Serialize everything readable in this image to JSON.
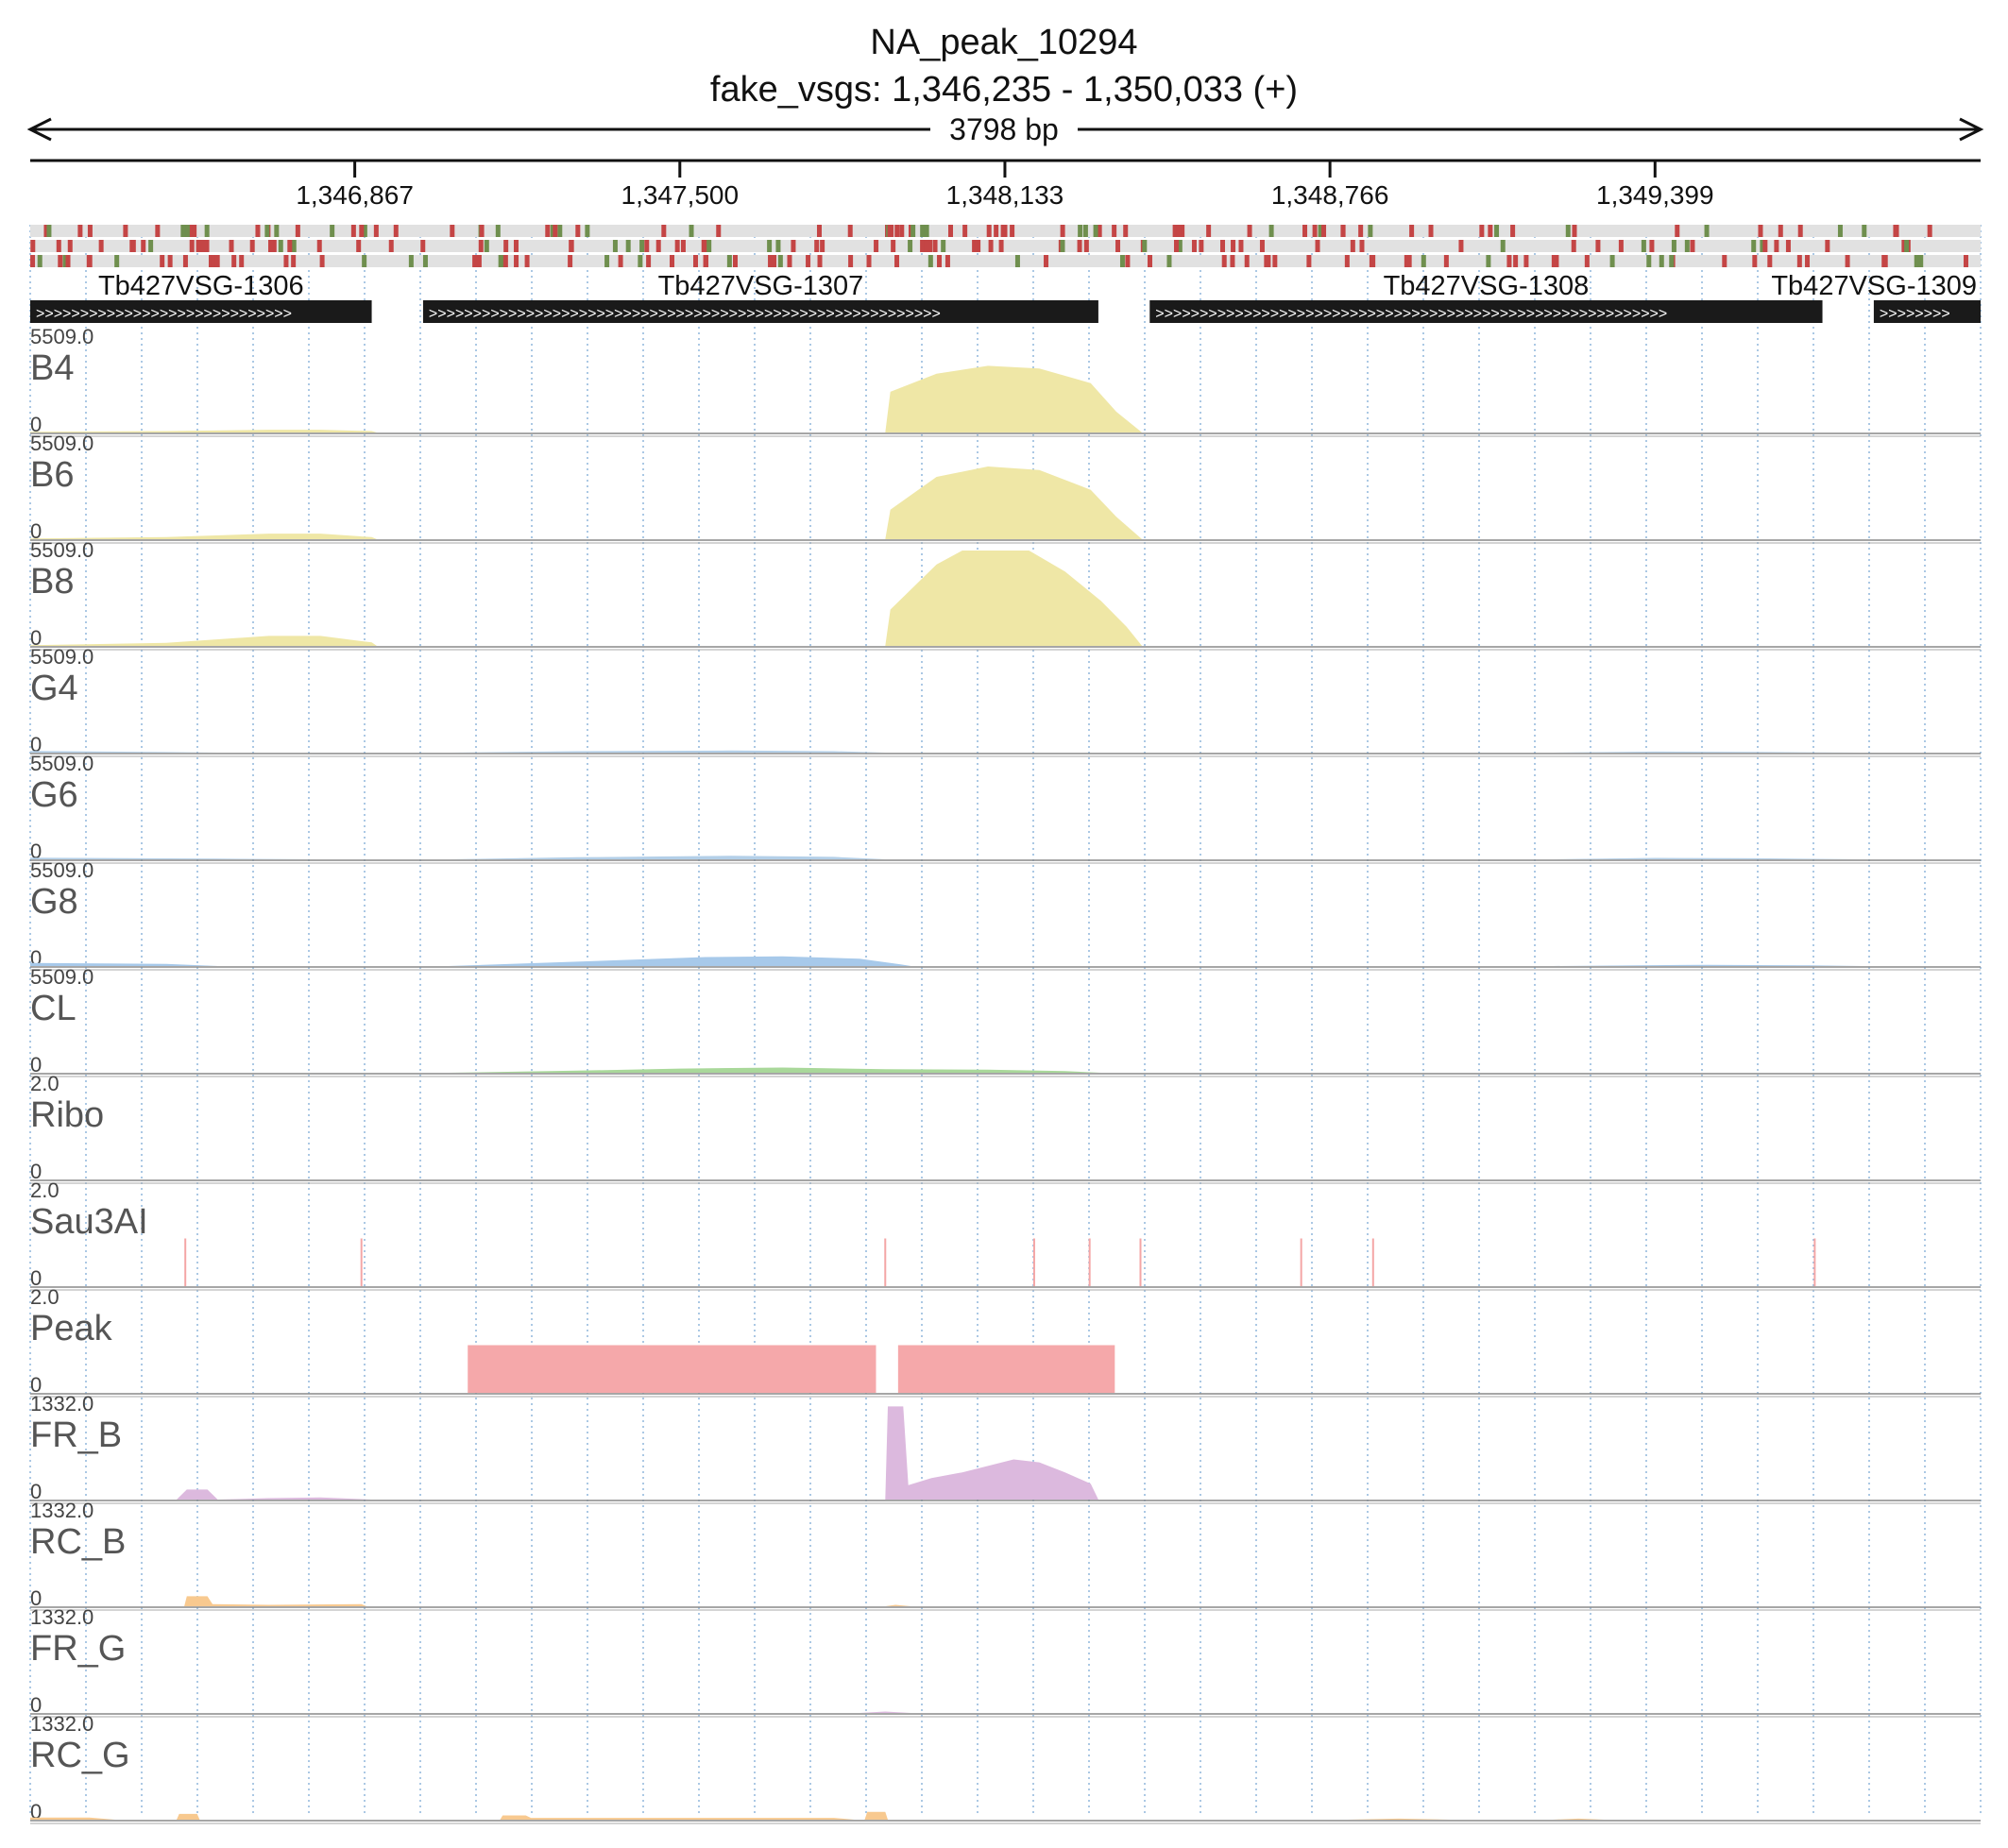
{
  "header": {
    "title": "NA_peak_10294",
    "subtitle": "fake_vsgs: 1,346,235 - 1,350,033 (+)",
    "span_label": "3798 bp"
  },
  "chart_data": {
    "type": "area",
    "title": "NA_peak_10294",
    "subtitle": "fake_vsgs: 1,346,235 - 1,350,033 (+)",
    "x_range": [
      1346235,
      1350033
    ],
    "x_ticks": [
      {
        "value": 1346867,
        "label": "1,346,867"
      },
      {
        "value": 1347500,
        "label": "1,347,500"
      },
      {
        "value": 1348133,
        "label": "1,348,133"
      },
      {
        "value": 1348766,
        "label": "1,348,766"
      },
      {
        "value": 1349399,
        "label": "1,349,399"
      }
    ],
    "grid": true,
    "genes": [
      {
        "name": "Tb427VSG-1306",
        "start": 1346235,
        "end": 1346900,
        "strand": "+"
      },
      {
        "name": "Tb427VSG-1307",
        "start": 1347000,
        "end": 1348315,
        "strand": "+"
      },
      {
        "name": "Tb427VSG-1308",
        "start": 1348415,
        "end": 1349725,
        "strand": "+"
      },
      {
        "name": "Tb427VSG-1309",
        "start": 1349825,
        "end": 1350033,
        "strand": "+"
      }
    ],
    "tracks": [
      {
        "name": "B4",
        "ymax_label": "5509.0",
        "ymin_label": "0",
        "ylim": [
          0,
          5509
        ],
        "color": "#efe7a6",
        "points": [
          [
            1346235,
            40
          ],
          [
            1346500,
            80
          ],
          [
            1346700,
            160
          ],
          [
            1346800,
            160
          ],
          [
            1346900,
            80
          ],
          [
            1346910,
            0
          ],
          [
            1347900,
            0
          ],
          [
            1347910,
            2350
          ],
          [
            1348000,
            3400
          ],
          [
            1348100,
            3850
          ],
          [
            1348200,
            3700
          ],
          [
            1348300,
            2850
          ],
          [
            1348350,
            1200
          ],
          [
            1348400,
            0
          ]
        ]
      },
      {
        "name": "B6",
        "ymax_label": "5509.0",
        "ymin_label": "0",
        "ylim": [
          0,
          5509
        ],
        "color": "#efe7a6",
        "points": [
          [
            1346235,
            40
          ],
          [
            1346500,
            120
          ],
          [
            1346700,
            320
          ],
          [
            1346800,
            320
          ],
          [
            1346900,
            120
          ],
          [
            1346910,
            0
          ],
          [
            1347900,
            0
          ],
          [
            1347910,
            1700
          ],
          [
            1348000,
            3600
          ],
          [
            1348100,
            4200
          ],
          [
            1348200,
            4000
          ],
          [
            1348300,
            2850
          ],
          [
            1348350,
            1300
          ],
          [
            1348400,
            0
          ]
        ]
      },
      {
        "name": "B8",
        "ymax_label": "5509.0",
        "ymin_label": "0",
        "ylim": [
          0,
          5509
        ],
        "color": "#efe7a6",
        "points": [
          [
            1346235,
            40
          ],
          [
            1346500,
            180
          ],
          [
            1346700,
            580
          ],
          [
            1346800,
            580
          ],
          [
            1346900,
            200
          ],
          [
            1346910,
            0
          ],
          [
            1347900,
            0
          ],
          [
            1347910,
            2100
          ],
          [
            1348000,
            4700
          ],
          [
            1348050,
            5509
          ],
          [
            1348180,
            5509
          ],
          [
            1348250,
            4300
          ],
          [
            1348320,
            2600
          ],
          [
            1348370,
            1100
          ],
          [
            1348400,
            0
          ]
        ]
      },
      {
        "name": "G4",
        "ymax_label": "5509.0",
        "ymin_label": "0",
        "ylim": [
          0,
          5509
        ],
        "color": "#b3cfe8",
        "points": [
          [
            1346235,
            100
          ],
          [
            1346500,
            30
          ],
          [
            1346600,
            0
          ],
          [
            1347050,
            0
          ],
          [
            1347300,
            80
          ],
          [
            1347600,
            120
          ],
          [
            1347800,
            80
          ],
          [
            1347900,
            0
          ],
          [
            1349200,
            0
          ],
          [
            1349400,
            60
          ],
          [
            1349600,
            40
          ],
          [
            1349800,
            0
          ]
        ]
      },
      {
        "name": "G6",
        "ymax_label": "5509.0",
        "ymin_label": "0",
        "ylim": [
          0,
          5509
        ],
        "color": "#b3cfe8",
        "points": [
          [
            1346235,
            90
          ],
          [
            1346600,
            40
          ],
          [
            1346800,
            0
          ],
          [
            1347050,
            0
          ],
          [
            1347300,
            120
          ],
          [
            1347600,
            200
          ],
          [
            1347800,
            140
          ],
          [
            1347900,
            0
          ],
          [
            1349200,
            0
          ],
          [
            1349400,
            80
          ],
          [
            1349600,
            60
          ],
          [
            1349800,
            0
          ]
        ]
      },
      {
        "name": "G8",
        "ymax_label": "5509.0",
        "ymin_label": "0",
        "ylim": [
          0,
          5509
        ],
        "color": "#a7c9ea",
        "points": [
          [
            1346235,
            180
          ],
          [
            1346500,
            120
          ],
          [
            1346600,
            0
          ],
          [
            1347050,
            0
          ],
          [
            1347300,
            250
          ],
          [
            1347550,
            520
          ],
          [
            1347700,
            560
          ],
          [
            1347850,
            420
          ],
          [
            1347930,
            100
          ],
          [
            1347950,
            0
          ],
          [
            1349200,
            0
          ],
          [
            1349500,
            70
          ],
          [
            1349700,
            40
          ],
          [
            1349800,
            0
          ]
        ]
      },
      {
        "name": "CL",
        "ymax_label": "5509.0",
        "ymin_label": "0",
        "ylim": [
          0,
          5509
        ],
        "color": "#a9d89a",
        "points": [
          [
            1347050,
            0
          ],
          [
            1347300,
            120
          ],
          [
            1347500,
            240
          ],
          [
            1347700,
            300
          ],
          [
            1347900,
            200
          ],
          [
            1348100,
            180
          ],
          [
            1348250,
            90
          ],
          [
            1348320,
            0
          ]
        ]
      },
      {
        "name": "Ribo",
        "ymax_label": "2.0",
        "ymin_label": "0",
        "ylim": [
          0,
          2
        ],
        "color": "#cccccc",
        "points": []
      },
      {
        "name": "Sau3AI",
        "ymax_label": "2.0",
        "ymin_label": "0",
        "ylim": [
          0,
          2
        ],
        "color": "#f4a6a6",
        "sites": [
          1346537,
          1346880,
          1347900,
          1348190,
          1348298,
          1348397,
          1348710,
          1348850,
          1349710
        ]
      },
      {
        "name": "Peak",
        "ymax_label": "2.0",
        "ymin_label": "0",
        "ylim": [
          0,
          2
        ],
        "color": "#f5a8aa",
        "blocks": [
          {
            "start": 1347087,
            "end": 1347882,
            "value": 1
          },
          {
            "start": 1347925,
            "end": 1348347,
            "value": 1
          }
        ]
      },
      {
        "name": "FR_B",
        "ymax_label": "1332.0",
        "ymin_label": "0",
        "ylim": [
          0,
          1332
        ],
        "color": "#dcb9de",
        "points": [
          [
            1346520,
            0
          ],
          [
            1346540,
            140
          ],
          [
            1346580,
            140
          ],
          [
            1346600,
            0
          ],
          [
            1346700,
            20
          ],
          [
            1346800,
            30
          ],
          [
            1346900,
            0
          ],
          [
            1347900,
            0
          ],
          [
            1347905,
            1300
          ],
          [
            1347935,
            1300
          ],
          [
            1347945,
            200
          ],
          [
            1347990,
            300
          ],
          [
            1348050,
            380
          ],
          [
            1348150,
            560
          ],
          [
            1348200,
            520
          ],
          [
            1348250,
            380
          ],
          [
            1348300,
            220
          ],
          [
            1348315,
            0
          ]
        ]
      },
      {
        "name": "RC_B",
        "ymax_label": "1332.0",
        "ymin_label": "0",
        "ylim": [
          0,
          1332
        ],
        "color": "#f8c98f",
        "points": [
          [
            1346535,
            0
          ],
          [
            1346540,
            140
          ],
          [
            1346580,
            140
          ],
          [
            1346590,
            30
          ],
          [
            1346700,
            20
          ],
          [
            1346880,
            30
          ],
          [
            1346890,
            0
          ],
          [
            1347900,
            0
          ],
          [
            1347920,
            20
          ],
          [
            1347950,
            0
          ]
        ]
      },
      {
        "name": "FR_G",
        "ymax_label": "1332.0",
        "ymin_label": "0",
        "ylim": [
          0,
          1332
        ],
        "color": "#dcb9de",
        "points": [
          [
            1347850,
            0
          ],
          [
            1347900,
            20
          ],
          [
            1347950,
            0
          ]
        ]
      },
      {
        "name": "RC_G",
        "ymax_label": "1332.0",
        "ymin_label": "0",
        "ylim": [
          0,
          1332
        ],
        "color": "#f8c98f",
        "points": [
          [
            1346235,
            30
          ],
          [
            1346350,
            30
          ],
          [
            1346400,
            0
          ],
          [
            1346520,
            0
          ],
          [
            1346525,
            80
          ],
          [
            1346560,
            80
          ],
          [
            1346565,
            0
          ],
          [
            1347150,
            0
          ],
          [
            1347155,
            60
          ],
          [
            1347200,
            60
          ],
          [
            1347210,
            25
          ],
          [
            1347800,
            25
          ],
          [
            1347840,
            0
          ],
          [
            1347860,
            0
          ],
          [
            1347865,
            110
          ],
          [
            1347900,
            110
          ],
          [
            1347905,
            0
          ],
          [
            1348800,
            0
          ],
          [
            1348900,
            15
          ],
          [
            1349000,
            0
          ],
          [
            1349200,
            0
          ],
          [
            1349250,
            15
          ],
          [
            1349300,
            0
          ]
        ]
      }
    ]
  }
}
